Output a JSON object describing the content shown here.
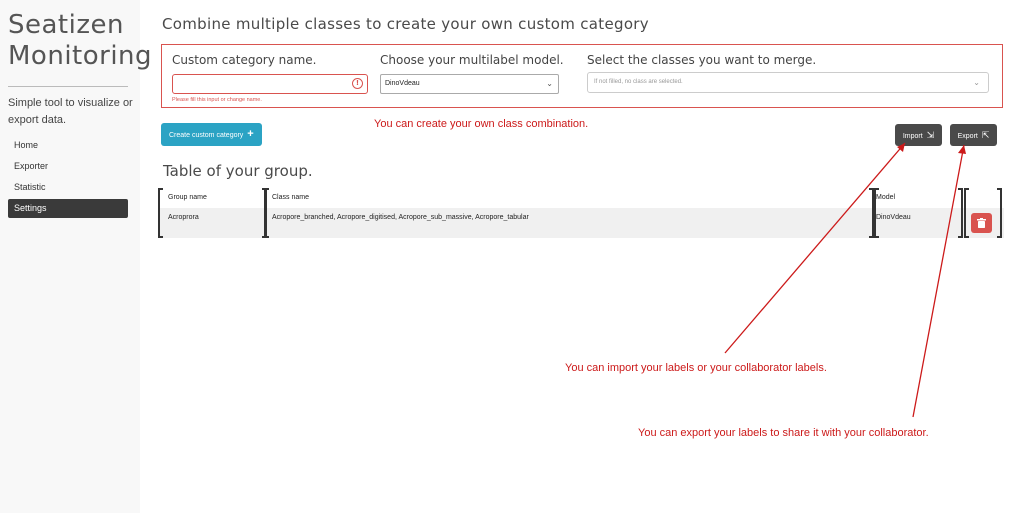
{
  "sidebar": {
    "title": "Seatizen Monitoring",
    "description": "Simple tool to visualize or export data.",
    "nav": [
      {
        "label": "Home",
        "active": false
      },
      {
        "label": "Exporter",
        "active": false
      },
      {
        "label": "Statistic",
        "active": false
      },
      {
        "label": "Settings",
        "active": true
      }
    ]
  },
  "main": {
    "title": "Combine multiple classes to create your own custom category",
    "form": {
      "name_label": "Custom category name.",
      "name_value": "",
      "name_error": "Please fill this input or change name.",
      "model_label": "Choose your multilabel model.",
      "model_value": "DinoVdeau",
      "classes_label": "Select the classes you want to merge.",
      "classes_placeholder": "If not filled, no class are selected."
    },
    "create_button": "Create custom category",
    "import_button": "Import",
    "export_button": "Export",
    "table_title": "Table of your group.",
    "table": {
      "headers": [
        "Group name",
        "Class name",
        "Model"
      ],
      "rows": [
        {
          "group": "Acroprora",
          "classes": "Acropore_branched, Acropore_digitised, Acropore_sub_massive, Acropore_tabular",
          "model": "DinoVdeau"
        }
      ]
    }
  },
  "annotations": {
    "create": "You can create your own class combination.",
    "import": "You can import your labels or your collaborator labels.",
    "export": "You can export your labels to share it with your collaborator."
  },
  "colors": {
    "accent": "#2ba3c4",
    "danger": "#d9534f",
    "dark_button": "#4a4a4a",
    "annotation": "#cc1a1a"
  }
}
